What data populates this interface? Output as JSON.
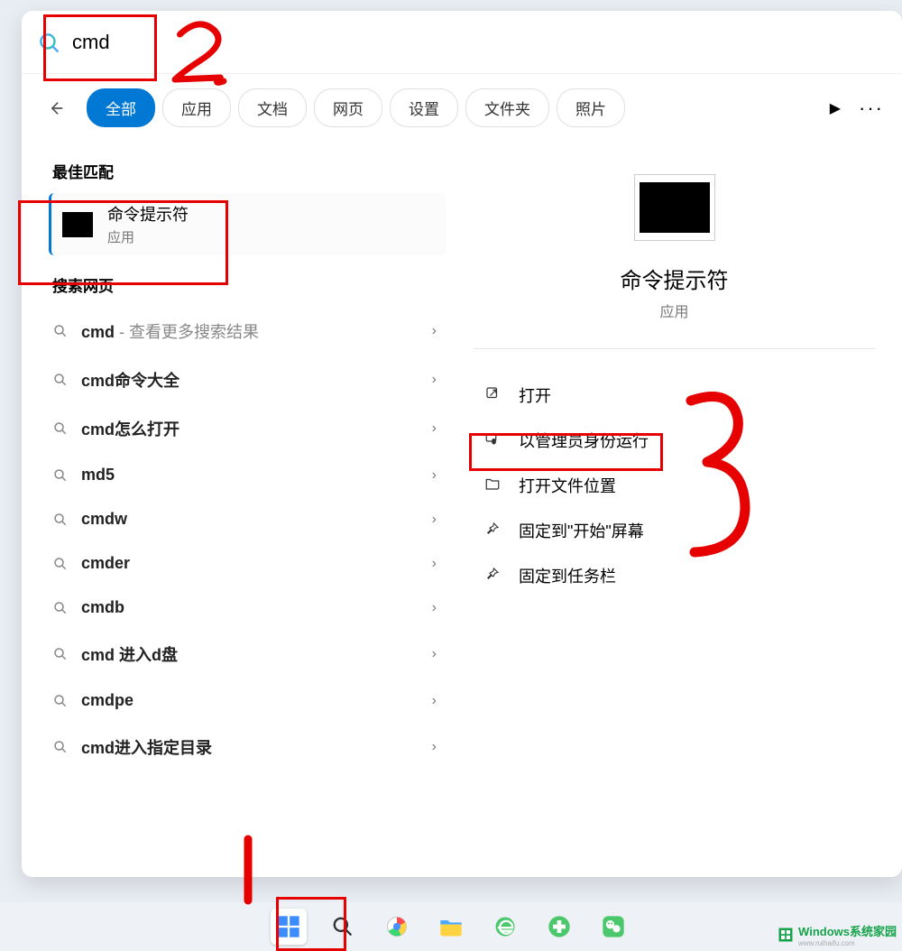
{
  "search": {
    "query": "cmd"
  },
  "tabs": {
    "all": "全部",
    "apps": "应用",
    "docs": "文档",
    "web": "网页",
    "settings": "设置",
    "folders": "文件夹",
    "photos": "照片"
  },
  "left": {
    "best_label": "最佳匹配",
    "best_title": "命令提示符",
    "best_sub": "应用",
    "web_label": "搜索网页",
    "items": [
      {
        "text": "cmd",
        "hint": " - 查看更多搜索结果"
      },
      {
        "text": "cmd命令大全",
        "hint": ""
      },
      {
        "text": "cmd怎么打开",
        "hint": ""
      },
      {
        "text": "md5",
        "hint": ""
      },
      {
        "text": "cmdw",
        "hint": ""
      },
      {
        "text": "cmder",
        "hint": ""
      },
      {
        "text": "cmdb",
        "hint": ""
      },
      {
        "text": "cmd 进入d盘",
        "hint": ""
      },
      {
        "text": "cmdpe",
        "hint": ""
      },
      {
        "text": "cmd进入指定目录",
        "hint": ""
      }
    ]
  },
  "preview": {
    "title": "命令提示符",
    "sub": "应用",
    "actions": {
      "open": "打开",
      "run_admin": "以管理员身份运行",
      "open_loc": "打开文件位置",
      "pin_start": "固定到\"开始\"屏幕",
      "pin_task": "固定到任务栏"
    }
  },
  "annotations": {
    "n1": "1",
    "n2": "2",
    "n3": "3"
  },
  "watermark": {
    "brand_w": "W",
    "brand_rest": "indows系统家园",
    "url": "www.ruihaifu.com"
  }
}
